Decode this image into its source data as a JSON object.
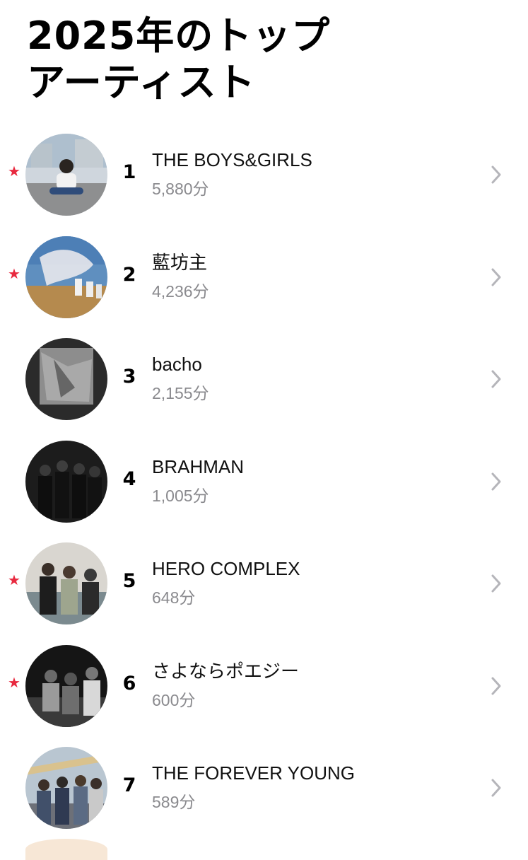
{
  "header": {
    "title_line1": "2025年のトップ",
    "title_line2": "アーティスト"
  },
  "colors": {
    "star": "#e8293f",
    "secondary_text": "#8a8a8e",
    "chevron": "#b5b5ba"
  },
  "artists": [
    {
      "rank": "1",
      "name": "THE BOYS&GIRLS",
      "minutes": "5,880分",
      "starred": true
    },
    {
      "rank": "2",
      "name": "藍坊主",
      "minutes": "4,236分",
      "starred": true
    },
    {
      "rank": "3",
      "name": "bacho",
      "minutes": "2,155分",
      "starred": false
    },
    {
      "rank": "4",
      "name": "BRAHMAN",
      "minutes": "1,005分",
      "starred": false
    },
    {
      "rank": "5",
      "name": "HERO COMPLEX",
      "minutes": "648分",
      "starred": true
    },
    {
      "rank": "6",
      "name": "さよならポエジー",
      "minutes": "600分",
      "starred": true
    },
    {
      "rank": "7",
      "name": "THE FOREVER YOUNG",
      "minutes": "589分",
      "starred": false
    }
  ],
  "icons": {
    "star": "★",
    "chevron": "chevron-right-icon"
  }
}
